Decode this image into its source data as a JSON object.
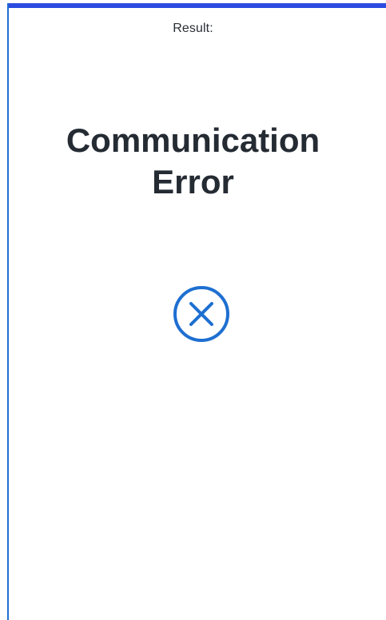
{
  "result": {
    "label": "Result:"
  },
  "status": {
    "title_line1": "Communication",
    "title_line2": "Error",
    "icon": "error-x-circle-icon",
    "icon_color": "#1e6fd1"
  },
  "colors": {
    "accent_bar": "#2b4ce0",
    "frame_edge": "#1e6fd1",
    "text": "#252b33"
  }
}
